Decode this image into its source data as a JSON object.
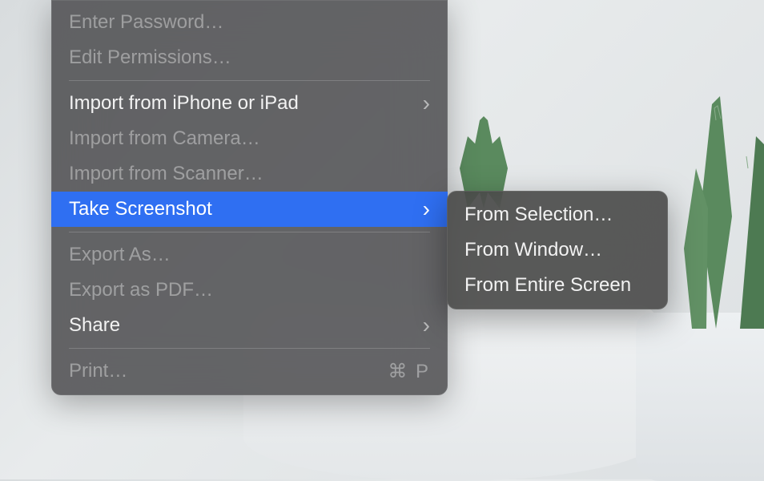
{
  "main_menu": {
    "items": [
      {
        "label": "Enter Password…",
        "enabled": false,
        "has_submenu": false
      },
      {
        "label": "Edit Permissions…",
        "enabled": false,
        "has_submenu": false
      },
      {
        "separator": true
      },
      {
        "label": "Import from iPhone or iPad",
        "enabled": true,
        "has_submenu": true
      },
      {
        "label": "Import from Camera…",
        "enabled": false,
        "has_submenu": false
      },
      {
        "label": "Import from Scanner…",
        "enabled": false,
        "has_submenu": false
      },
      {
        "label": "Take Screenshot",
        "enabled": true,
        "has_submenu": true,
        "highlighted": true
      },
      {
        "separator": true
      },
      {
        "label": "Export As…",
        "enabled": false,
        "has_submenu": false
      },
      {
        "label": "Export as PDF…",
        "enabled": false,
        "has_submenu": false
      },
      {
        "label": "Share",
        "enabled": true,
        "has_submenu": true
      },
      {
        "separator": true
      },
      {
        "label": "Print…",
        "enabled": false,
        "has_submenu": false,
        "shortcut": "⌘ P"
      }
    ]
  },
  "submenu": {
    "items": [
      {
        "label": "From Selection…"
      },
      {
        "label": "From Window…"
      },
      {
        "label": "From Entire Screen"
      }
    ]
  }
}
